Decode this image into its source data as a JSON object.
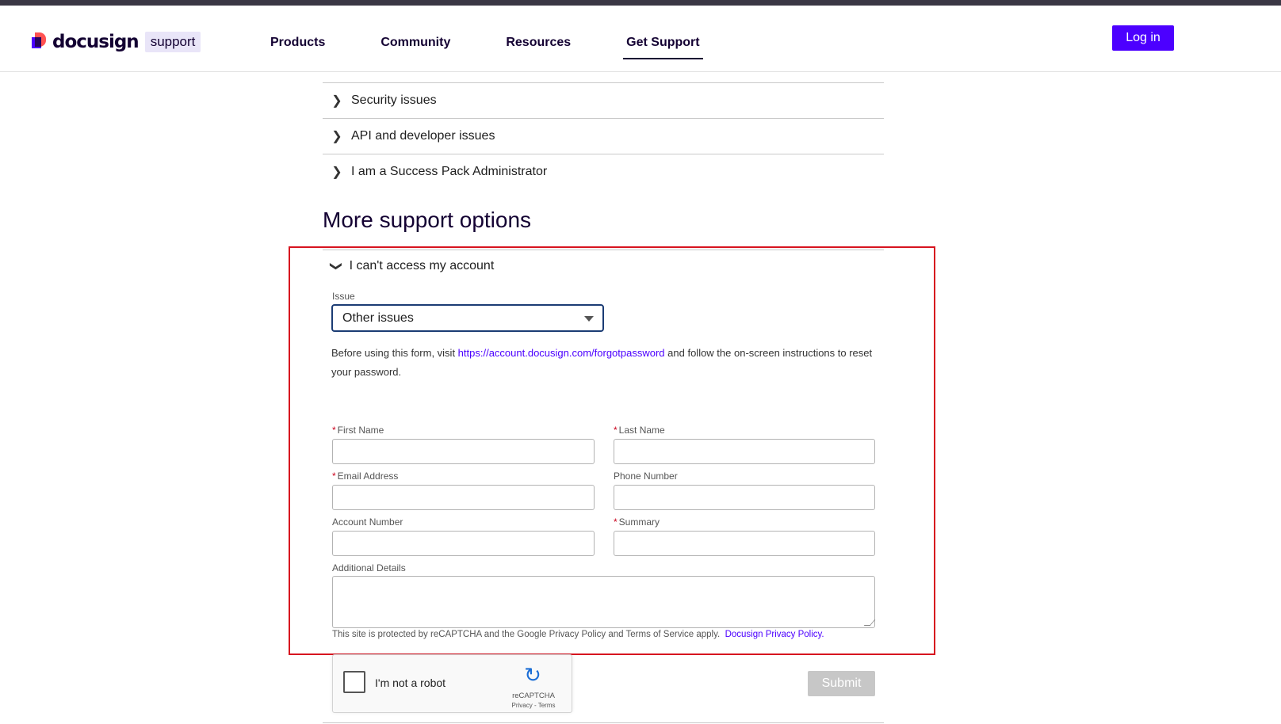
{
  "header": {
    "logo_word": "docusign",
    "logo_tag": "support",
    "nav": [
      "Products",
      "Community",
      "Resources",
      "Get Support"
    ],
    "active_nav": "Get Support",
    "login_label": "Log in"
  },
  "accordion": {
    "items": [
      "Security issues",
      "API and developer issues",
      "I am a Success Pack Administrator"
    ]
  },
  "more_support": {
    "title": "More support options",
    "open_item": "I can't access my account"
  },
  "form": {
    "issue_label": "Issue",
    "issue_value": "Other issues",
    "notice_before": "Before using this form, visit ",
    "notice_link": "https://account.docusign.com/forgotpassword",
    "notice_after": " and follow the on-screen instructions to reset your password.",
    "first_name_label": "First Name",
    "last_name_label": "Last Name",
    "email_label": "Email Address",
    "phone_label": "Phone Number",
    "account_label": "Account Number",
    "summary_label": "Summary",
    "details_label": "Additional Details",
    "required_mark": "*",
    "recaptcha_notice": "This site is protected by reCAPTCHA and the Google Privacy Policy and Terms of Service apply.",
    "privacy_link": "Docusign Privacy Policy.",
    "submit_label": "Submit"
  },
  "recaptcha": {
    "label": "I'm not a robot",
    "brand": "reCAPTCHA",
    "terms": "Privacy - Terms"
  },
  "colors": {
    "accent": "#4c00ff",
    "highlight_border": "#d7131f",
    "select_border": "#1b3c74"
  }
}
